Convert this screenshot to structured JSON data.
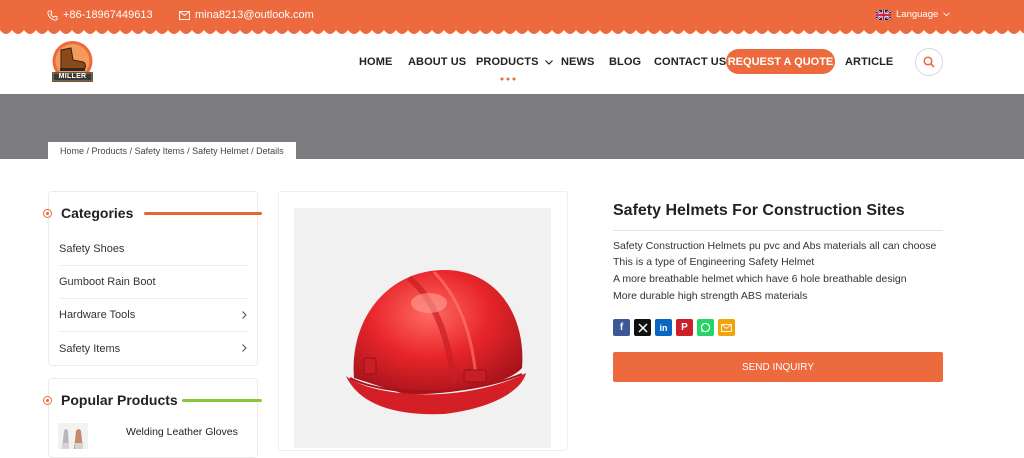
{
  "topbar": {
    "phone": "+86-18967449613",
    "email": "mina8213@outlook.com",
    "language": "Language"
  },
  "logo": {
    "text": "MILLER"
  },
  "nav": {
    "home": "HOME",
    "about": "ABOUT US",
    "products": "PRODUCTS",
    "news": "NEWS",
    "blog": "BLOG",
    "contact": "CONTACT US",
    "quote": "REQUEST A QUOTE",
    "article": "ARTICLE"
  },
  "breadcrumb": {
    "items": [
      "Home",
      "Products",
      "Safety Items",
      "Safety Helmet",
      "Details"
    ],
    "separator": " / "
  },
  "sidebar": {
    "categories_title": "Categories",
    "categories": [
      {
        "label": "Safety Shoes",
        "has_children": false
      },
      {
        "label": "Gumboot Rain Boot",
        "has_children": false
      },
      {
        "label": "Hardware Tools",
        "has_children": true
      },
      {
        "label": "Safety Items",
        "has_children": true
      }
    ],
    "popular_title": "Popular Products",
    "popular": [
      {
        "label": "Welding Leather Gloves"
      }
    ]
  },
  "product": {
    "title": "Safety Helmets For Construction Sites",
    "description": [
      "Safety Construction Helmets pu pvc and Abs materials all can choose",
      "This is a type of Engineering Safety Helmet",
      "A more breathable helmet which have 6 hole breathable design",
      "More durable high strength ABS materials"
    ],
    "share_icons": [
      "facebook-icon",
      "x-icon",
      "linkedin-icon",
      "pinterest-icon",
      "whatsapp-icon",
      "email-icon"
    ],
    "inquiry_label": "SEND INQUIRY"
  },
  "colors": {
    "accent": "#ec6a3d",
    "banner": "#7c7c7e",
    "green_underline": "#8cc63e",
    "helmet": "#e8262b"
  }
}
